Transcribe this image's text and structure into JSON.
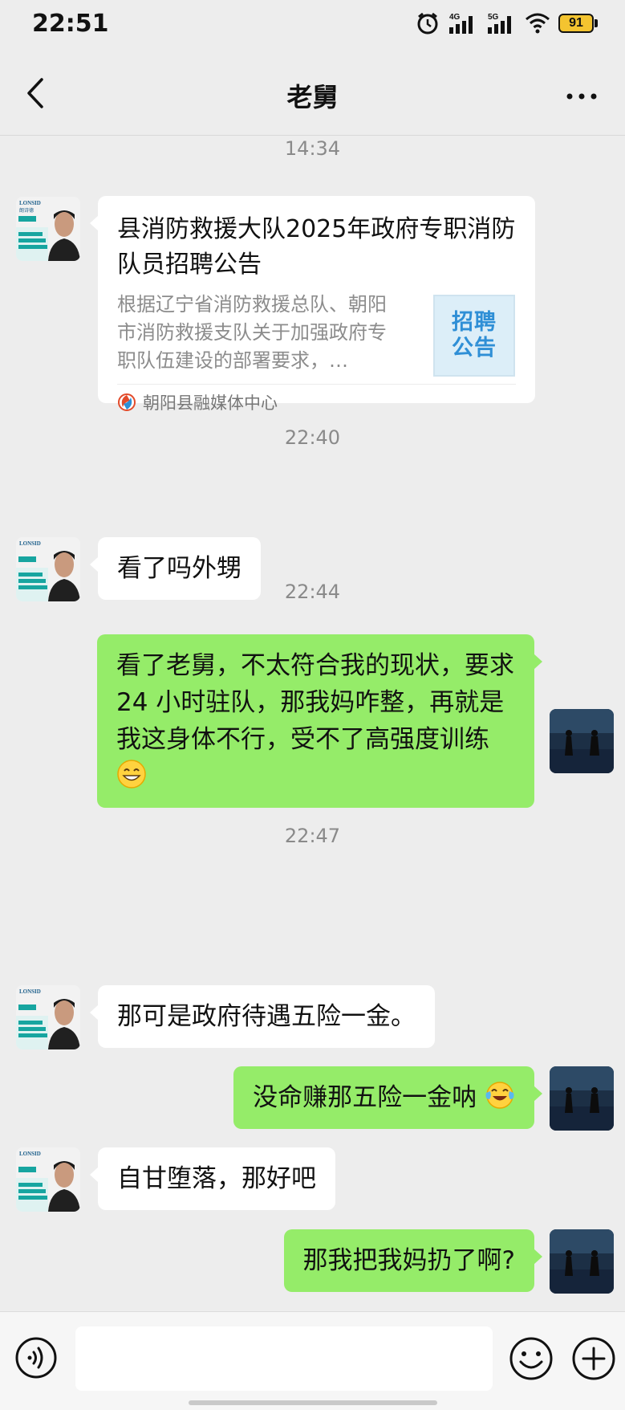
{
  "status_bar": {
    "time": "22:51",
    "battery": "91",
    "network_labels": [
      "4G",
      "5G"
    ]
  },
  "nav": {
    "title": "老舅"
  },
  "messages": {
    "ts1": "14:34",
    "card": {
      "title": "县消防救援大队2025年政府专职消防队员招聘公告",
      "description": "根据辽宁省消防救援总队、朝阳市消防救援支队关于加强政府专职队伍建设的部署要求，…",
      "thumb_line1": "招聘",
      "thumb_line2": "公告",
      "source": "朝阳县融媒体中心"
    },
    "ts2": "22:40",
    "m1": "看了吗外甥",
    "ts3": "22:44",
    "m2": "看了老舅，不太符合我的现状，要求 24 小时驻队，那我妈咋整，再就是我这身体不行，受不了高强度训练",
    "ts4": "22:47",
    "m3": "那可是政府待遇五险一金。",
    "m4": "没命赚那五险一金呐",
    "m5": "自甘堕落，那好吧",
    "m6": "那我把我妈扔了啊?"
  },
  "avatar_left_text": {
    "brand": "LONSID",
    "lines": [
      "朗诗德",
      "招商加盟"
    ]
  },
  "icons": {
    "back": "chevron-left-icon",
    "more": "more-dots-icon",
    "voice": "voice-icon",
    "emoji": "emoji-icon",
    "add": "plus-icon",
    "grin": "grin-emoji",
    "laugh": "tears-of-joy-emoji"
  },
  "colors": {
    "background": "#ededed",
    "self_bubble": "#95ec69",
    "other_bubble": "#ffffff",
    "battery": "#f4c430"
  }
}
